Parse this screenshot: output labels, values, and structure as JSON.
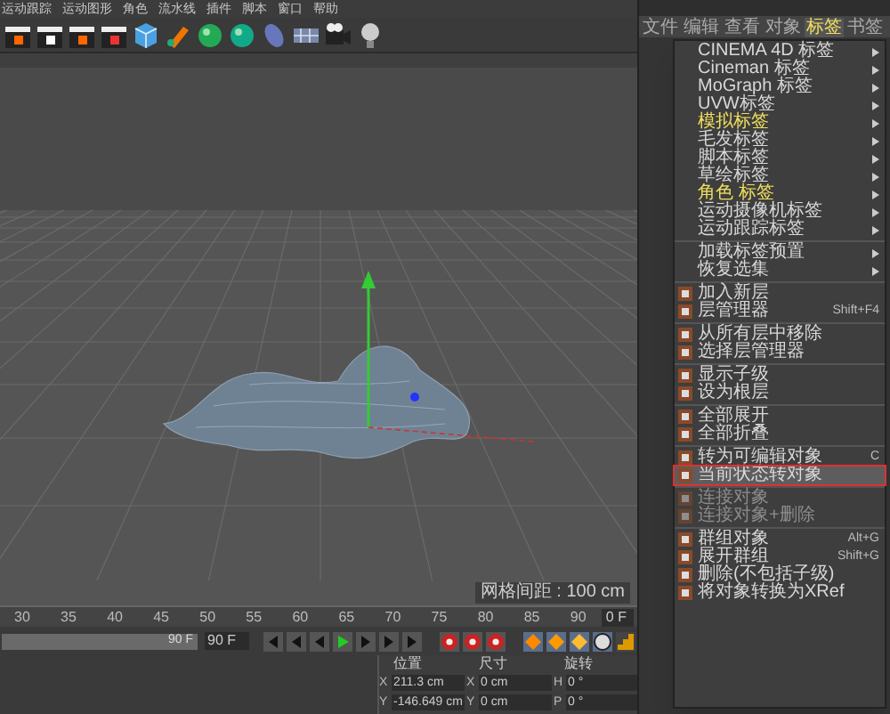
{
  "menu_bar": [
    "运动跟踪",
    "运动图形",
    "角色",
    "流水线",
    "插件",
    "脚本",
    "窗口",
    "帮助"
  ],
  "viewport": {
    "grid_label": "网格间距 : 100 cm"
  },
  "timeline": {
    "ticks": [
      "30",
      "35",
      "40",
      "45",
      "50",
      "55",
      "60",
      "65",
      "70",
      "75",
      "80",
      "85",
      "90"
    ],
    "current_frame": "0 F",
    "slider": {
      "label": "90 F",
      "level": 1
    },
    "end_field": "90 F"
  },
  "coordinates": {
    "columns": [
      "位置",
      "尺寸",
      "旋转"
    ],
    "rows": [
      {
        "axis": "X",
        "position": "211.3 cm",
        "size_axis": "X",
        "size": "0 cm",
        "rot_axis": "H",
        "rotation": "0 °"
      },
      {
        "axis": "Y",
        "position": "-146.649 cm",
        "size_axis": "Y",
        "size": "0 cm",
        "rot_axis": "P",
        "rotation": "0 °"
      }
    ]
  },
  "object_manager": {
    "tabs": [
      {
        "label": "文件",
        "selected": false
      },
      {
        "label": "编辑",
        "selected": false
      },
      {
        "label": "查看",
        "selected": false
      },
      {
        "label": "对象",
        "selected": false
      },
      {
        "label": "标签",
        "selected": true
      },
      {
        "label": "书签",
        "selected": false
      }
    ]
  },
  "context_menu": {
    "groups": [
      [
        {
          "kind": "submenu",
          "label": "CINEMA 4D 标签",
          "emphasized": false,
          "disabled": false,
          "selected": false
        },
        {
          "kind": "submenu",
          "label": "Cineman 标签",
          "emphasized": false,
          "disabled": false,
          "selected": false
        },
        {
          "kind": "submenu",
          "label": "MoGraph 标签",
          "emphasized": false,
          "disabled": false,
          "selected": false
        },
        {
          "kind": "submenu",
          "label": "UVW标签",
          "emphasized": false,
          "disabled": false,
          "selected": false
        },
        {
          "kind": "submenu",
          "label": "模拟标签",
          "emphasized": true,
          "disabled": false,
          "selected": false
        },
        {
          "kind": "submenu",
          "label": "毛发标签",
          "emphasized": false,
          "disabled": false,
          "selected": false
        },
        {
          "kind": "submenu",
          "label": "脚本标签",
          "emphasized": false,
          "disabled": false,
          "selected": false
        },
        {
          "kind": "submenu",
          "label": "草绘标签",
          "emphasized": false,
          "disabled": false,
          "selected": false
        },
        {
          "kind": "submenu",
          "label": "角色 标签",
          "emphasized": true,
          "disabled": false,
          "selected": false
        },
        {
          "kind": "submenu",
          "label": "运动摄像机标签",
          "emphasized": false,
          "disabled": false,
          "selected": false
        },
        {
          "kind": "submenu",
          "label": "运动跟踪标签",
          "emphasized": false,
          "disabled": false,
          "selected": false
        }
      ],
      [
        {
          "kind": "submenu",
          "label": "加载标签预置",
          "emphasized": false,
          "disabled": false,
          "selected": false
        },
        {
          "kind": "submenu",
          "label": "恢复选集",
          "emphasized": false,
          "disabled": false,
          "selected": false
        }
      ],
      [
        {
          "kind": "action",
          "label": "加入新层",
          "emphasized": false,
          "disabled": false,
          "selected": false
        },
        {
          "kind": "action",
          "label": "层管理器",
          "shortcut": "Shift+F4",
          "emphasized": false,
          "disabled": false,
          "selected": false
        }
      ],
      [
        {
          "kind": "action",
          "label": "从所有层中移除",
          "emphasized": false,
          "disabled": false,
          "selected": false
        },
        {
          "kind": "action",
          "label": "选择层管理器",
          "emphasized": false,
          "disabled": false,
          "selected": false
        }
      ],
      [
        {
          "kind": "action",
          "label": "显示子级",
          "emphasized": false,
          "disabled": false,
          "selected": false
        },
        {
          "kind": "action",
          "label": "设为根层",
          "emphasized": false,
          "disabled": false,
          "selected": false
        }
      ],
      [
        {
          "kind": "action",
          "label": "全部展开",
          "emphasized": false,
          "disabled": false,
          "selected": false
        },
        {
          "kind": "action",
          "label": "全部折叠",
          "emphasized": false,
          "disabled": false,
          "selected": false
        }
      ],
      [
        {
          "kind": "action",
          "label": "转为可编辑对象",
          "shortcut": "C",
          "emphasized": false,
          "disabled": false,
          "selected": false
        },
        {
          "kind": "action",
          "label": "当前状态转对象",
          "emphasized": false,
          "disabled": false,
          "selected": true
        }
      ],
      [
        {
          "kind": "action",
          "label": "连接对象",
          "emphasized": false,
          "disabled": true,
          "selected": false
        },
        {
          "kind": "action",
          "label": "连接对象+删除",
          "emphasized": false,
          "disabled": true,
          "selected": false
        }
      ],
      [
        {
          "kind": "action",
          "label": "群组对象",
          "shortcut": "Alt+G",
          "emphasized": false,
          "disabled": false,
          "selected": false
        },
        {
          "kind": "action",
          "label": "展开群组",
          "shortcut": "Shift+G",
          "emphasized": false,
          "disabled": false,
          "selected": false
        },
        {
          "kind": "action",
          "label": "删除(不包括子级)",
          "emphasized": false,
          "disabled": false,
          "selected": false
        },
        {
          "kind": "action",
          "label": "将对象转换为XRef",
          "emphasized": false,
          "disabled": false,
          "selected": false
        }
      ]
    ]
  }
}
